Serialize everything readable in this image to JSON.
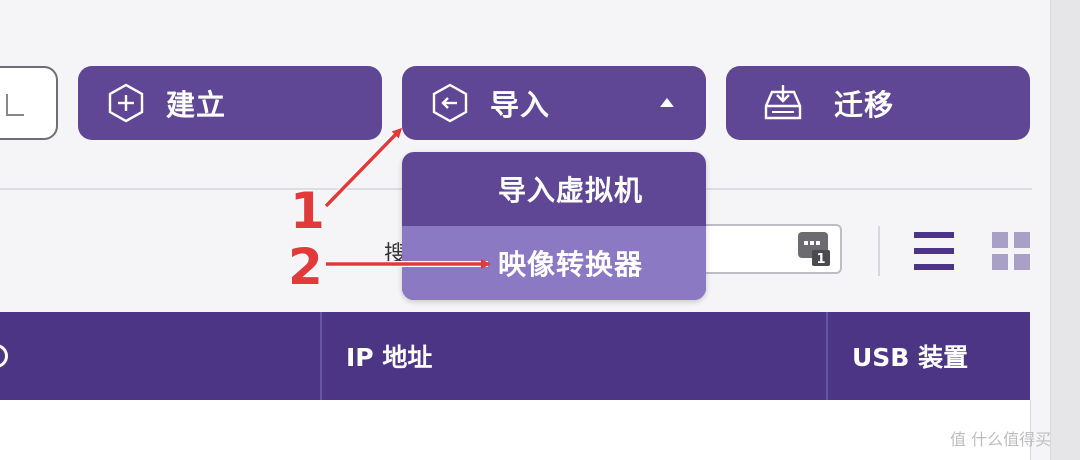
{
  "toolbar": {
    "create_label": "建立",
    "import_label": "导入",
    "migrate_label": "迁移"
  },
  "import_menu": {
    "items": [
      {
        "label": "导入虚拟机"
      },
      {
        "label": "映像转换器"
      }
    ]
  },
  "filter": {
    "search_label_fragment": "搜",
    "filter_badge": "1"
  },
  "table": {
    "columns": [
      "IP 地址",
      "USB 装置"
    ]
  },
  "annotations": {
    "step1": "1",
    "step2": "2"
  },
  "watermark": {
    "text": "值 什么值得买"
  },
  "colors": {
    "button_purple": "#5f4796",
    "menu_highlight": "#8b79c4",
    "header_purple": "#4d3585",
    "annotation_red": "#e23a3a"
  },
  "icons": {
    "create": "plus-hexagon-icon",
    "import": "import-hexagon-icon",
    "migrate": "migrate-tray-icon",
    "dropdown_caret": "caret-up-icon",
    "filter": "filter-badge-icon",
    "list_view": "list-view-icon",
    "grid_view": "grid-view-icon"
  }
}
